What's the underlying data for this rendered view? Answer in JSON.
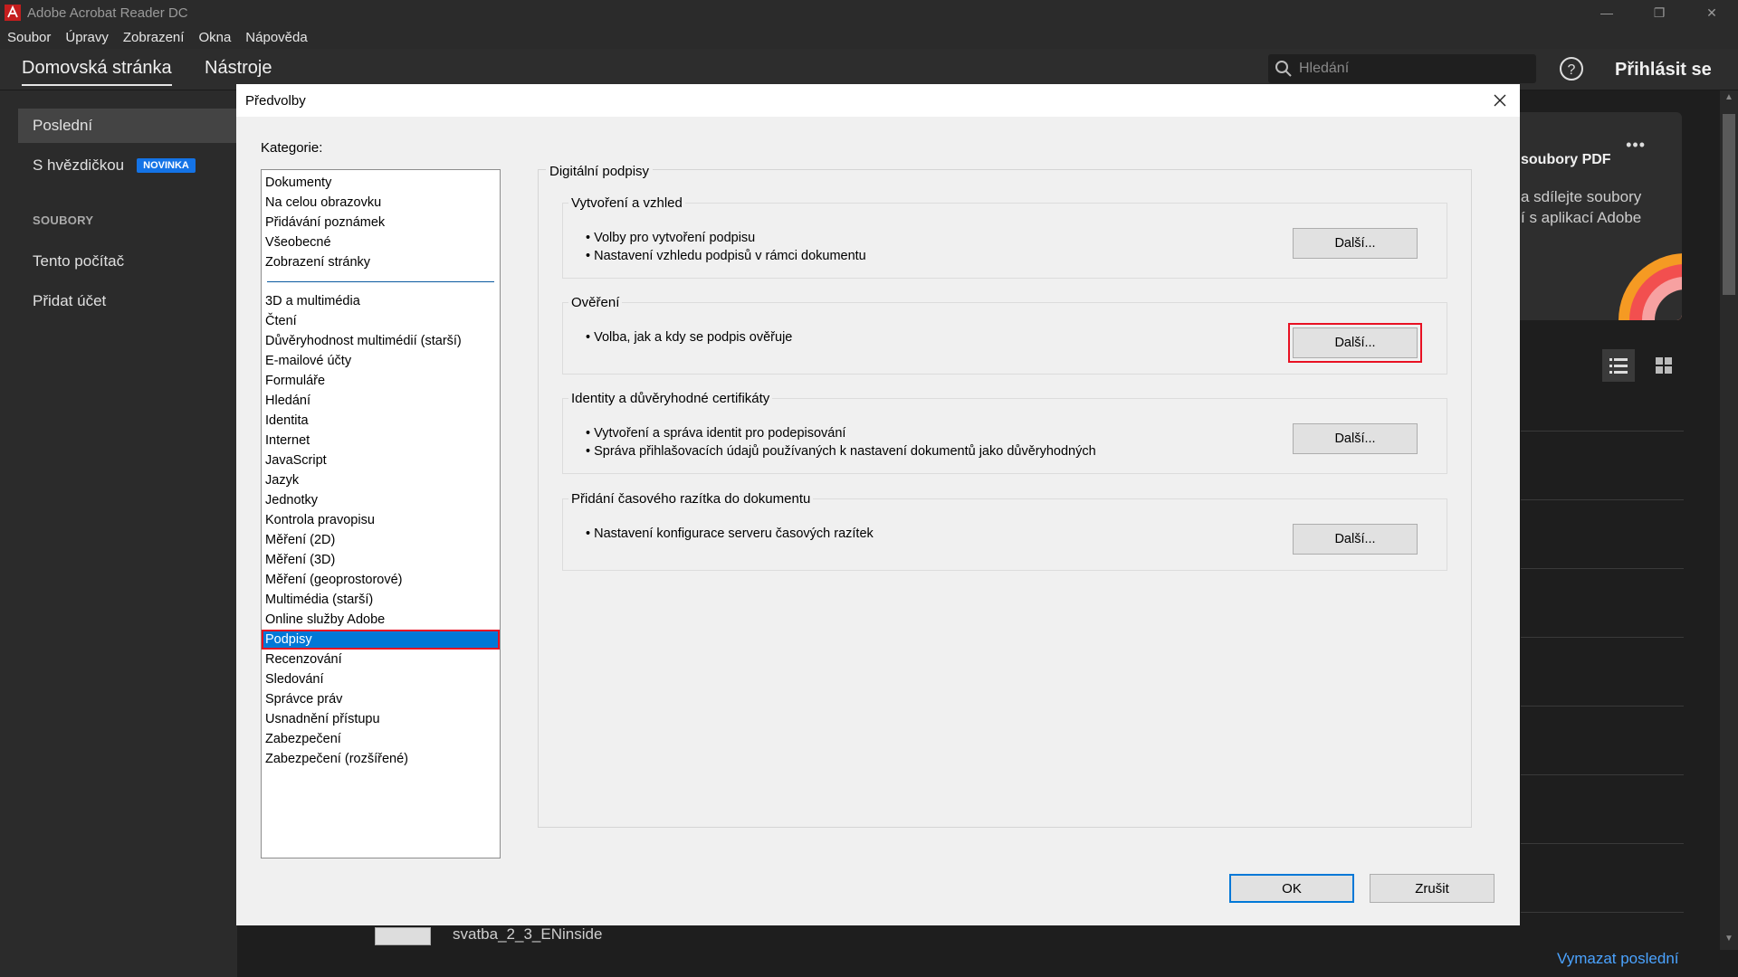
{
  "app": {
    "title": "Adobe Acrobat Reader DC",
    "accent": "#1473e6"
  },
  "menu": [
    "Soubor",
    "Úpravy",
    "Zobrazení",
    "Okna",
    "Nápověda"
  ],
  "toolbar": {
    "tabs": [
      "Domovská stránka",
      "Nástroje"
    ],
    "search_placeholder": "Hledání",
    "signin": "Přihlásit se"
  },
  "sidebar": {
    "recent": "Poslední",
    "starred": "S hvězdičkou",
    "new_badge": "NOVINKA",
    "files_header": "SOUBORY",
    "this_computer": "Tento počítač",
    "add_account": "Přidat účet"
  },
  "background": {
    "promo_title": "soubory PDF",
    "promo_line1": "a sdílejte soubory",
    "promo_line2": "í s aplikací Adobe",
    "file_name": "svatba_2_3_ENinside",
    "clear_recent": "Vymazat poslední"
  },
  "dialog": {
    "title": "Předvolby",
    "category_label": "Kategorie:",
    "categories_top": [
      "Dokumenty",
      "Na celou obrazovku",
      "Přidávání poznámek",
      "Všeobecné",
      "Zobrazení stránky"
    ],
    "categories": [
      "3D a multimédia",
      "Čtení",
      "Důvěryhodnost multimédií (starší)",
      "E-mailové účty",
      "Formuláře",
      "Hledání",
      "Identita",
      "Internet",
      "JavaScript",
      "Jazyk",
      "Jednotky",
      "Kontrola pravopisu",
      "Měření (2D)",
      "Měření (3D)",
      "Měření (geoprostorové)",
      "Multimédia (starší)",
      "Online služby Adobe",
      "Podpisy",
      "Recenzování",
      "Sledování",
      "Správce práv",
      "Usnadnění přístupu",
      "Zabezpečení",
      "Zabezpečení (rozšířené)"
    ],
    "selected_category": "Podpisy",
    "panel_title": "Digitální podpisy",
    "groups": [
      {
        "title": "Vytvoření a vzhled",
        "bullets": [
          "Volby pro vytvoření podpisu",
          "Nastavení vzhledu podpisů v rámci dokumentu"
        ],
        "button": "Další..."
      },
      {
        "title": "Ověření",
        "bullets": [
          "Volba, jak a kdy se podpis ověřuje"
        ],
        "button": "Další..."
      },
      {
        "title": "Identity a důvěryhodné certifikáty",
        "bullets": [
          "Vytvoření a správa identit pro podepisování",
          "Správa přihlašovacích údajů používaných k nastavení dokumentů jako důvěryhodných"
        ],
        "button": "Další..."
      },
      {
        "title": "Přidání časového razítka do dokumentu",
        "bullets": [
          "Nastavení konfigurace serveru časových razítek"
        ],
        "button": "Další..."
      }
    ],
    "ok": "OK",
    "cancel": "Zrušit"
  }
}
